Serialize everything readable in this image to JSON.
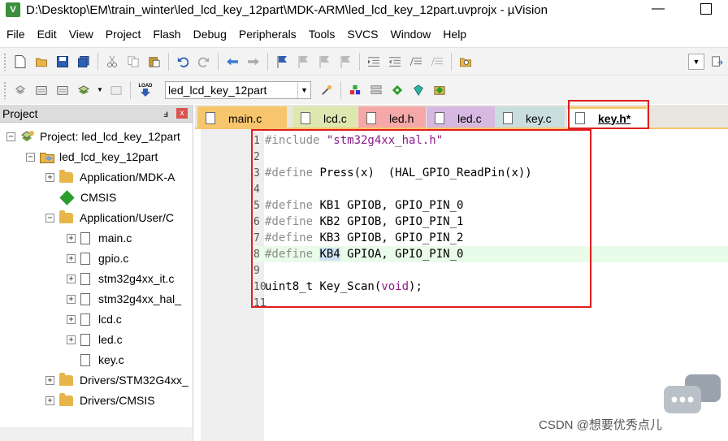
{
  "window": {
    "title": "D:\\Desktop\\EM\\train_winter\\led_lcd_key_12part\\MDK-ARM\\led_lcd_key_12part.uvprojx - µVision",
    "icon_label": "V",
    "minimize_glyph": "—"
  },
  "menu": [
    "File",
    "Edit",
    "View",
    "Project",
    "Flash",
    "Debug",
    "Peripherals",
    "Tools",
    "SVCS",
    "Window",
    "Help"
  ],
  "toolbar2": {
    "load_label": "LOAD",
    "target_value": "led_lcd_key_12part"
  },
  "project_panel": {
    "title": "Project",
    "pin_glyph": "ⅎ",
    "close_glyph": "x",
    "tree": [
      {
        "label": "Project: led_lcd_key_12part",
        "kind": "project",
        "expander": "−"
      },
      {
        "label": "led_lcd_key_12part",
        "kind": "target",
        "expander": "−"
      },
      {
        "label": "Application/MDK-A",
        "kind": "folder",
        "expander": "+"
      },
      {
        "label": "CMSIS",
        "kind": "component",
        "expander": ""
      },
      {
        "label": "Application/User/C",
        "kind": "folder-open",
        "expander": "−"
      },
      {
        "label": "main.c",
        "kind": "file",
        "expander": "+"
      },
      {
        "label": "gpio.c",
        "kind": "file",
        "expander": "+"
      },
      {
        "label": "stm32g4xx_it.c",
        "kind": "file",
        "expander": "+"
      },
      {
        "label": "stm32g4xx_hal_",
        "kind": "file",
        "expander": "+"
      },
      {
        "label": "lcd.c",
        "kind": "file",
        "expander": "+"
      },
      {
        "label": "led.c",
        "kind": "file",
        "expander": "+"
      },
      {
        "label": "key.c",
        "kind": "file",
        "expander": ""
      },
      {
        "label": "Drivers/STM32G4xx_",
        "kind": "folder",
        "expander": "+"
      },
      {
        "label": "Drivers/CMSIS",
        "kind": "folder",
        "expander": "+"
      }
    ]
  },
  "tabs": [
    {
      "label": "main.c",
      "color": "#f7c56b",
      "active": false
    },
    {
      "label": "lcd.c",
      "color": "#dfe7b0",
      "active": false
    },
    {
      "label": "led.h",
      "color": "#f4a8a8",
      "active": false
    },
    {
      "label": "led.c",
      "color": "#d7b8e0",
      "active": false
    },
    {
      "label": "key.c",
      "color": "#c9dede",
      "active": false
    },
    {
      "label": "key.h*",
      "color": "#f7c56b",
      "active": true
    }
  ],
  "code": [
    {
      "n": "1",
      "parts": [
        {
          "t": "#include ",
          "c": "pp"
        },
        {
          "t": "\"stm32g4xx_hal.h\"",
          "c": "str"
        }
      ]
    },
    {
      "n": "2",
      "parts": []
    },
    {
      "n": "3",
      "parts": [
        {
          "t": "#define ",
          "c": "pp"
        },
        {
          "t": "Press(x)  (HAL_GPIO_ReadPin(x))",
          "c": ""
        }
      ]
    },
    {
      "n": "4",
      "parts": []
    },
    {
      "n": "5",
      "parts": [
        {
          "t": "#define ",
          "c": "pp"
        },
        {
          "t": "KB1 GPIOB, GPIO_PIN_0",
          "c": ""
        }
      ]
    },
    {
      "n": "6",
      "parts": [
        {
          "t": "#define ",
          "c": "pp"
        },
        {
          "t": "KB2 GPIOB, GPIO_PIN_1",
          "c": ""
        }
      ]
    },
    {
      "n": "7",
      "parts": [
        {
          "t": "#define ",
          "c": "pp"
        },
        {
          "t": "KB3 GPIOB, GPIO_PIN_2",
          "c": ""
        }
      ]
    },
    {
      "n": "8",
      "parts": [
        {
          "t": "#define ",
          "c": "pp"
        },
        {
          "t": "KB4",
          "c": "hlw"
        },
        {
          "t": " GPIOA, GPIO_PIN_0",
          "c": ""
        }
      ],
      "highlight": true
    },
    {
      "n": "9",
      "parts": []
    },
    {
      "n": "10",
      "parts": [
        {
          "t": "uint8_t Key_Scan(",
          "c": ""
        },
        {
          "t": "void",
          "c": "str"
        },
        {
          "t": ");",
          "c": ""
        }
      ]
    },
    {
      "n": "11",
      "parts": []
    }
  ],
  "watermark": "CSDN @想要优秀点儿"
}
